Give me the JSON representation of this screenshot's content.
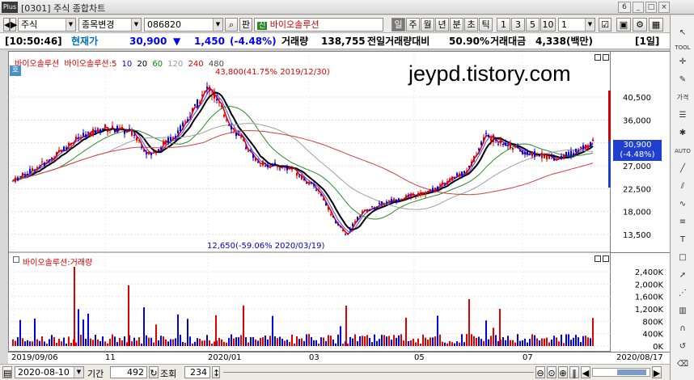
{
  "window": {
    "title": "[0301] 주식 종합차트",
    "logo": "Plus",
    "page_num": "6"
  },
  "toolbar": {
    "market": "주식",
    "symbol_change": "종목변경",
    "code": "086820",
    "ban_label": "판",
    "stock_name": "바이오솔루션",
    "periods": [
      "일",
      "주",
      "월",
      "년",
      "분",
      "초",
      "틱"
    ],
    "minute_opts": [
      "1",
      "3",
      "5",
      "10"
    ],
    "interval": "1"
  },
  "quote": {
    "time": "[10:50:46]",
    "price_label": "현재가",
    "price": "30,900",
    "change_arrow": "▼",
    "change": "1,450",
    "change_pct": "(-4.48%)",
    "volume_label": "거래량",
    "volume": "138,755",
    "prev_ratio_label": "전일거래량대비",
    "prev_ratio": "50.90%",
    "amount_label": "거래대금",
    "amount": "4,338(백만)",
    "period_badge": "[1일]"
  },
  "chart": {
    "watermark": "jeypd.tistory.com",
    "legend_name": "바이오솔루션",
    "legend_ma_name": "바이오솔루션:5",
    "ma_periods": [
      "10",
      "20",
      "60",
      "120",
      "240",
      "480"
    ],
    "max_annotation": "43,800(41.75% 2019/12/30)",
    "min_annotation": "12,650(-59.06% 2020/03/19)",
    "current_label": "30,900",
    "current_pct": "(-4.48%)",
    "volume_legend": "바이오솔루션:거래량",
    "ho_badge": "호"
  },
  "chart_data": {
    "type": "candlestick",
    "price_ticks": [
      "40,500",
      "36,000",
      "31,500",
      "27,000",
      "22,500",
      "18,000",
      "13,500"
    ],
    "volume_ticks": [
      "2,400K",
      "2,000K",
      "1,600K",
      "1,200K",
      "800K",
      "400K",
      "0K"
    ],
    "date_ticks": [
      "2019/09/06",
      "11",
      "2020/01",
      "03",
      "05",
      "07",
      "2020/08/17"
    ],
    "high": 43800,
    "low": 12650,
    "last": 30900
  },
  "status": {
    "date": "2020-08-10",
    "period_label": "기간",
    "period": "492",
    "lookup_label": "조회",
    "lookup": "234"
  },
  "sidebar": {
    "labels": [
      "TOOL",
      "가격",
      "AUTO"
    ]
  }
}
